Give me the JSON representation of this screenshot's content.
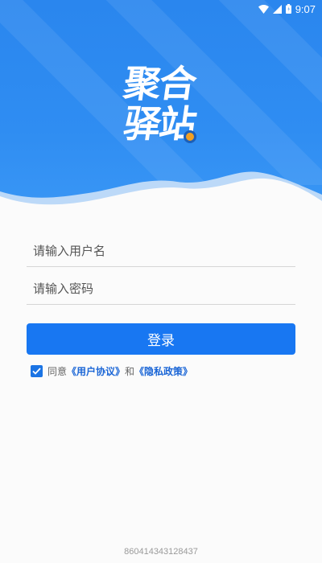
{
  "status_bar": {
    "time": "9:07",
    "icons": [
      "wifi-icon",
      "signal-icon",
      "battery-icon"
    ]
  },
  "logo": {
    "line1": "聚合",
    "line2": "驿站"
  },
  "form": {
    "username_placeholder": "请输入用户名",
    "username_value": "",
    "password_placeholder": "请输入密码",
    "password_value": ""
  },
  "login_button": "登录",
  "agreement": {
    "checked": true,
    "prefix": "同意",
    "user_agreement": "《用户协议》",
    "conjunction": "和",
    "privacy_policy": "《隐私政策》"
  },
  "footer": {
    "device_id": "860414343128437"
  },
  "colors": {
    "header_blue": "#2f8df2",
    "button_blue": "#1877f2",
    "link_blue": "#1b66d6",
    "logo_dot": "#f2a023"
  }
}
